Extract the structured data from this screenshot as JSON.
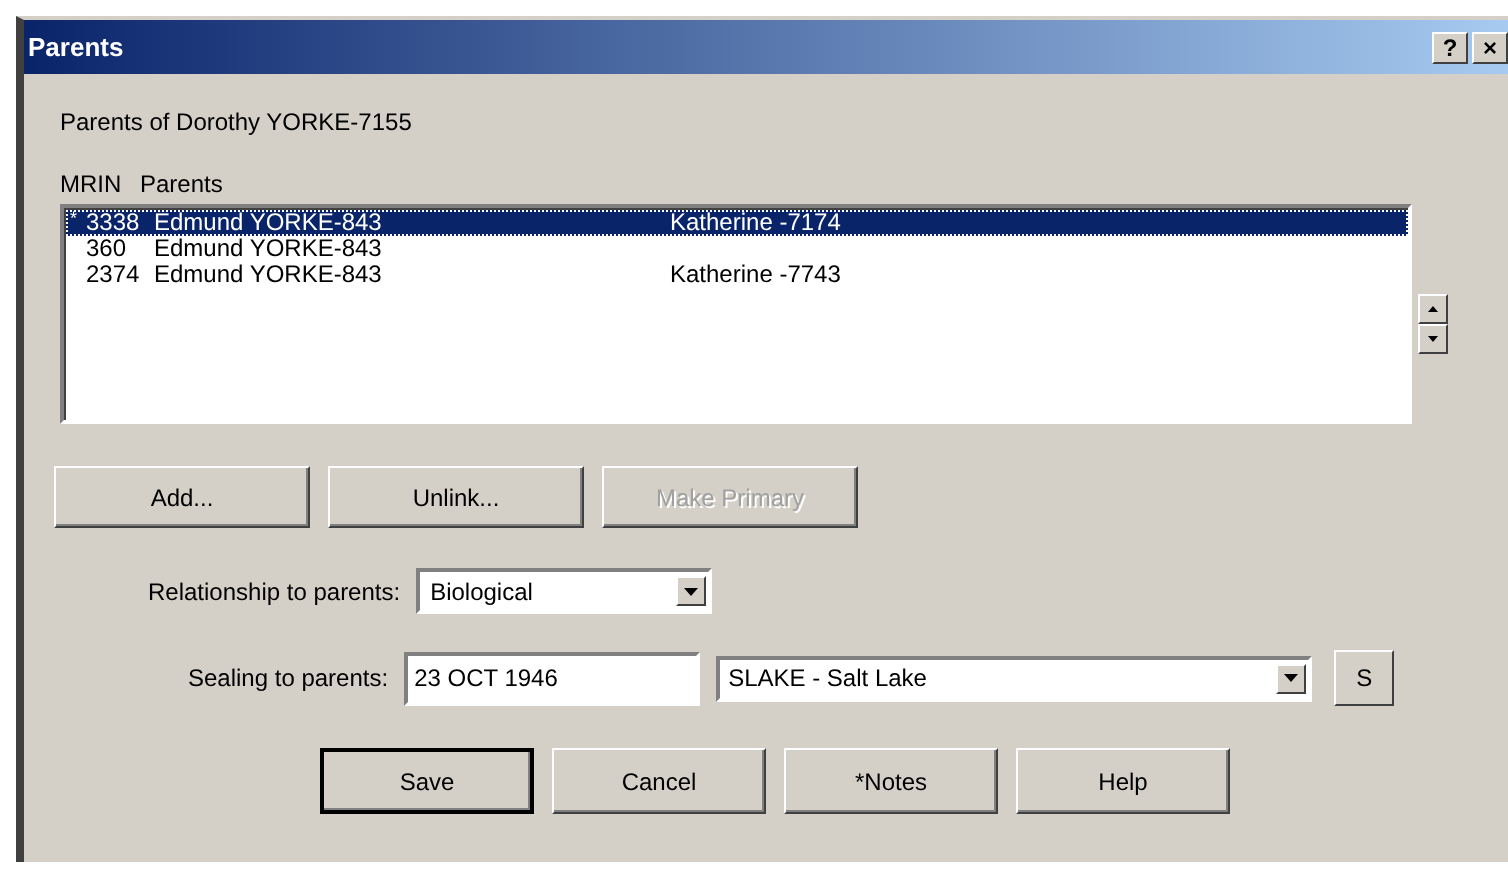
{
  "window": {
    "title": "Parents",
    "title_buttons": [
      "?",
      "×"
    ]
  },
  "heading": "Parents of Dorothy YORKE-7155",
  "list": {
    "columns": [
      "MRIN",
      "Parents"
    ],
    "rows": [
      {
        "primary": "*",
        "mrin": "3338",
        "father": "Edmund YORKE-843",
        "mother": "Katherine -7174",
        "selected": true
      },
      {
        "mrin": "360",
        "father": "Edmund YORKE-843",
        "selected": false
      },
      {
        "mrin": "2374",
        "father": "Edmund YORKE-843",
        "mother": "Katherine -7743",
        "selected": false
      }
    ]
  },
  "list_buttons": [
    {
      "label": "Add...",
      "disabled": false
    },
    {
      "label": "Unlink...",
      "disabled": false
    },
    {
      "label": "Make Primary",
      "disabled": true
    }
  ],
  "relationship": {
    "label": "Relationship to parents:",
    "value": "Biological"
  },
  "sealing": {
    "label": "Sealing to parents:",
    "date": "23 OCT 1946",
    "temple": "SLAKE - Salt Lake",
    "button": "S"
  },
  "buttons": [
    {
      "label": "Save",
      "default": true
    },
    {
      "label": "Cancel",
      "default": false
    },
    {
      "label": "*Notes",
      "default": false
    },
    {
      "label": "Help",
      "default": false
    }
  ]
}
